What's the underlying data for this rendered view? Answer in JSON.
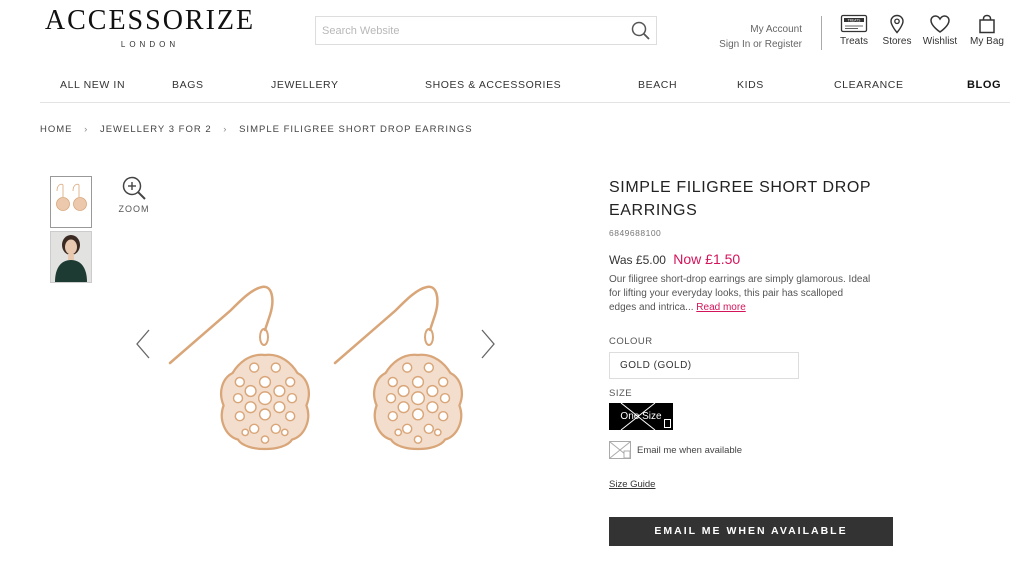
{
  "brand": {
    "name": "ACCESSORIZE",
    "sub": "LONDON"
  },
  "search": {
    "placeholder": "Search Website"
  },
  "account": {
    "line1": "My Account",
    "line2": "Sign In or Register"
  },
  "header_icons": {
    "treats": "Treats",
    "stores": "Stores",
    "wishlist": "Wishlist",
    "bag": "My Bag",
    "treats_card_text": "TREATS"
  },
  "nav": [
    "ALL NEW IN",
    "BAGS",
    "JEWELLERY",
    "SHOES & ACCESSORIES",
    "BEACH",
    "KIDS",
    "CLEARANCE",
    "BLOG"
  ],
  "breadcrumb": [
    "HOME",
    "JEWELLERY 3 FOR 2",
    "SIMPLE FILIGREE SHORT DROP EARRINGS"
  ],
  "gallery": {
    "zoom_label": "ZOOM"
  },
  "product": {
    "title_line1": "SIMPLE FILIGREE SHORT DROP",
    "title_line2": "EARRINGS",
    "sku": "6849688100",
    "was_price": "Was £5.00",
    "now_price": "Now £1.50",
    "description": "Our filigree short-drop earrings are simply glamorous. Ideal for lifting your everyday looks, this pair has scalloped edges and intrica...",
    "read_more": "Read more",
    "colour_label": "COLOUR",
    "colour_value": "GOLD (GOLD)",
    "size_label": "SIZE",
    "size_value": "One Size",
    "notify_label": "Email me when available",
    "size_guide": "Size Guide",
    "cta": "EMAIL ME WHEN AVAILABLE"
  },
  "colors": {
    "accent": "#d4145a",
    "cta_bg": "#333333",
    "gold": "#d9a679"
  }
}
